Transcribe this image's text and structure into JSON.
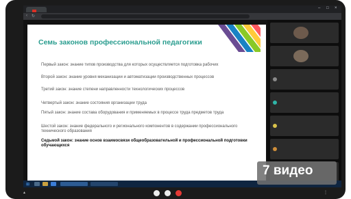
{
  "browser": {
    "tab_title": "",
    "window_title": "",
    "url": ""
  },
  "slide": {
    "title": "Семь законов профессиональной педагогики",
    "laws": [
      "Первый закон: знание типов производства для которых осуществляется подготовка рабочих",
      "Второй закон: знание уровня механизации и автоматизации производственных процессов",
      "Третий закон: знание степени направленности технологических процессов",
      "Четвертый закон: знание состояния организации труда",
      "Пятый закон: знание состава оборудования и применяемых в процессе труда предметов труда",
      "Шестой закон: знание федерального и регионального компонентов в содержании профессионального технического образования",
      "Седьмой закон: знание основ взаимосвязи общеобразовательной и профессиональной подготовки обучающихся"
    ]
  },
  "overlay": {
    "badge_text": "7 видео"
  },
  "colors": {
    "title": "#2a9d8f",
    "stripe1": "#6a4c93",
    "stripe2": "#1982c4",
    "stripe3": "#8ac926",
    "stripe4": "#ffca3a",
    "stripe5": "#ff595e"
  }
}
